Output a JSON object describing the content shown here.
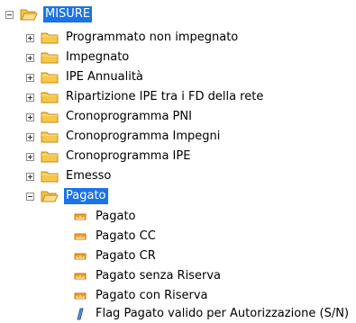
{
  "tree": {
    "root": {
      "label": "MISURE",
      "icon": "folder-open-icon",
      "selected": true
    },
    "children": [
      {
        "label": "Programmato non impegnato",
        "icon": "folder-icon"
      },
      {
        "label": "Impegnato",
        "icon": "folder-icon"
      },
      {
        "label": "IPE Annualità",
        "icon": "folder-icon"
      },
      {
        "label": "Ripartizione IPE tra i FD della rete",
        "icon": "folder-icon"
      },
      {
        "label": "Cronoprogramma PNI",
        "icon": "folder-icon"
      },
      {
        "label": "Cronoprogramma Impegni",
        "icon": "folder-icon"
      },
      {
        "label": "Cronoprogramma IPE",
        "icon": "folder-icon"
      },
      {
        "label": "Emesso",
        "icon": "folder-icon"
      },
      {
        "label": "Pagato",
        "icon": "folder-open-icon",
        "selected": true
      }
    ],
    "pagato_children": [
      {
        "label": "Pagato",
        "icon": "measure-icon"
      },
      {
        "label": "Pagato CC",
        "icon": "measure-icon"
      },
      {
        "label": "Pagato CR",
        "icon": "measure-icon"
      },
      {
        "label": "Pagato senza Riserva",
        "icon": "measure-icon"
      },
      {
        "label": "Pagato con Riserva",
        "icon": "measure-icon"
      },
      {
        "label": "Flag Pagato valido per Autorizzazione (S/N)",
        "icon": "flag-attribute-icon"
      }
    ]
  },
  "colors": {
    "selection": "#1a73e8",
    "folder": "#f5c84a",
    "measure": "#f0a020",
    "flag": "#5b8fd6"
  }
}
